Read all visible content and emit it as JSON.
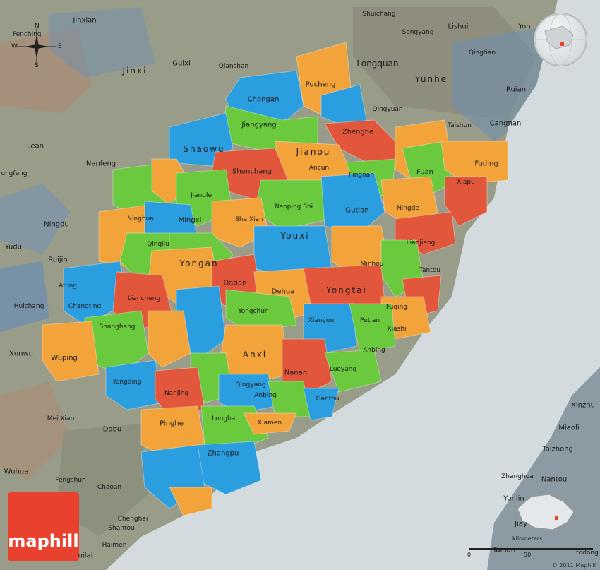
{
  "compass": {
    "place": "Fenching",
    "n": "N",
    "e": "E",
    "s": "S",
    "w": "W"
  },
  "brand": {
    "label": "maphill",
    "color": "#e8412e"
  },
  "scale": {
    "title": "kilometers",
    "zero": "0",
    "fifty": "50"
  },
  "copyright": "© 2011 Maphill",
  "colors": {
    "orange": "#f2a33a",
    "blue": "#2b9ee0",
    "green": "#6ac93c",
    "red": "#e2573b",
    "sea": "#d2dade",
    "outside": "#9aa79a"
  },
  "labels": {
    "jinxian": "Jinxian",
    "guixi": "Guixi",
    "jinxi": "Jinxi",
    "qianshan": "Qianshan",
    "shuichang": "Shuichang",
    "songyang": "Songyang",
    "lishui": "Lishui",
    "yongjia": "Yon",
    "longquan": "Longquan",
    "qingtian": "Qingtian",
    "yunhe": "Yunhe",
    "ruian": "Ruian",
    "qingyuan": "Qingyuan",
    "taishun": "Taishun",
    "cangnan": "Cangnan",
    "pucheng": "Pucheng",
    "chongan": "Chongan",
    "jiangyang": "Jiangyang",
    "zhenghe": "Zhenghe",
    "shaowu": "Shaowu",
    "jianou": "Jianou",
    "ancun": "Ancun",
    "shunchang": "Shunchang",
    "fuan": "Fuan",
    "fuding": "Fuding",
    "pingnan": "Pingnan",
    "xiapu": "Xiapu",
    "lean": "Lean",
    "nanfeng": "Nanfeng",
    "yongfeng": "ongfeng",
    "ningdu": "Ningdu",
    "yudu": "Yudu",
    "ruijin": "Ruijin",
    "huichang": "Huichang",
    "xunwu": "Xunwu",
    "jiangle": "Jiangle",
    "ninghua": "Ninghua",
    "mingxi": "Mingxi",
    "shaxian": "Sha Xian",
    "nanping": "Nanping Shi",
    "gutian": "Gutian",
    "ningde": "Ningde",
    "youxi": "Youxi",
    "qingliu": "Qingliu",
    "yongan": "Yongan",
    "lianjiang": "Lianjiang",
    "minhou": "Minhou",
    "tantou": "Tantou",
    "atiing": "Atiing",
    "changting": "Changting",
    "liancheng": "Liancheng",
    "datian": "Datian",
    "dehua": "Dehua",
    "yongtai": "Yongtai",
    "yongchun": "Yongchun",
    "fuqing": "Fuqing",
    "xianyou": "Xianyou",
    "putian": "Putian",
    "xiashi": "Xiashi",
    "shanghang": "Shanghang",
    "wuping": "Wuping",
    "anxi": "Anxi",
    "anbing": "Anbing",
    "nanan": "Nanan",
    "luoyang": "Luoyang",
    "yongding": "Yongding",
    "qingyang": "Qingyang",
    "nanjing": "Nanjing",
    "anbing2": "Anbing",
    "gantou": "Gantou",
    "meixian": "Mei Xian",
    "dabu": "Dabu",
    "pinghe": "Pinghe",
    "longhai": "Longhai",
    "xiamen": "Xiamen",
    "zhangpu": "Zhangpu",
    "wuhua": "Wuhua",
    "fengshun": "Fengshun",
    "chaoan": "Chaoan",
    "chenghai": "Chenghai",
    "shantou": "Shantou",
    "huilai": "uilai",
    "haimen": "Haimen",
    "xinzhu": "Xinzhu",
    "miaoli": "Miaoli",
    "taizhong": "Taizhong",
    "zhanghua": "Zhanghua",
    "nantou": "Nantou",
    "yunlin": "Yunlin",
    "jiayi": "Jiay",
    "tainan": "Tainan",
    "todong": "todong"
  }
}
